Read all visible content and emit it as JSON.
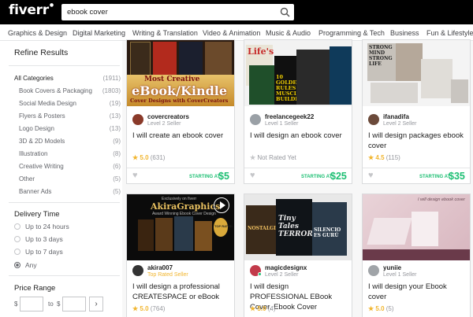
{
  "header": {
    "logo": "fiverr",
    "search_value": "ebook cover"
  },
  "nav": {
    "items": [
      "Graphics & Design",
      "Digital Marketing",
      "Writing & Translation",
      "Video & Animation",
      "Music & Audio",
      "Programming & Tech",
      "Business",
      "Fun & Lifestyle"
    ]
  },
  "sidebar": {
    "title": "Refine Results",
    "categories": [
      {
        "label": "All Categories",
        "count": "(1911)"
      },
      {
        "label": "Book Covers & Packaging",
        "count": "(1803)"
      },
      {
        "label": "Social Media Design",
        "count": "(19)"
      },
      {
        "label": "Flyers & Posters",
        "count": "(13)"
      },
      {
        "label": "Logo Design",
        "count": "(13)"
      },
      {
        "label": "3D & 2D Models",
        "count": "(9)"
      },
      {
        "label": "Illustration",
        "count": "(8)"
      },
      {
        "label": "Creative Writing",
        "count": "(6)"
      },
      {
        "label": "Other",
        "count": "(5)"
      },
      {
        "label": "Banner Ads",
        "count": "(5)"
      }
    ],
    "delivery_title": "Delivery Time",
    "delivery_options": [
      "Up to 24 hours",
      "Up to 3 days",
      "Up to 7 days",
      "Any"
    ],
    "delivery_selected": "Any",
    "price_title": "Price Range",
    "price_currency": "$",
    "price_to": "to",
    "price_go": "›"
  },
  "gigs": [
    {
      "seller": "covercreators",
      "level": "Level 2 Seller",
      "title": "I will create an ebook cover",
      "rating": "5.0",
      "reviews": "(631)",
      "starting": "STARTING AT",
      "price": "$5",
      "thumb_text": [
        "Most Creative",
        "eBook/Kindle",
        "Cover Designs with CoverCreators"
      ]
    },
    {
      "seller": "freelancegeek22",
      "level": "Level 1 Seller",
      "title": "I will design an ebook cover",
      "rating": "",
      "reviews": "Not Rated Yet",
      "starting": "STARTING AT",
      "price": "$25",
      "thumb_text": [
        "Life's",
        "10 GOLDEN RULES OF MUSCLE BUILDING"
      ]
    },
    {
      "seller": "ifanadifa",
      "level": "Level 2 Seller",
      "title": "I will design packages ebook cover",
      "rating": "4.5",
      "reviews": "(115)",
      "starting": "STARTING AT",
      "price": "$35",
      "thumb_text": [
        "STRONG MIND STRONG LIFE"
      ]
    },
    {
      "seller": "akira007",
      "level": "Top Rated Seller",
      "title": "I will design a professional CREATESPACE or eBook",
      "rating": "5.0",
      "reviews": "(764)",
      "thumb_text": [
        "Exclusively on fiverr",
        "AkiraGraphics",
        "Award Winning Ebook Cover Design",
        "TOP RATED"
      ]
    },
    {
      "seller": "magicdesignx",
      "level": "Level 2 Seller",
      "title": "I will design PROFESSIONAL EBook Cover, Ebook Cover",
      "rating": "5.0",
      "reviews": "(4)",
      "thumb_text": [
        "NOSTALGIA",
        "Tiny Tales TERROR",
        "SILENCIO ES GURÚ"
      ]
    },
    {
      "seller": "yuniie",
      "level": "Level 1 Seller",
      "title": "I will design your Ebook cover",
      "rating": "5.0",
      "reviews": "(5)",
      "thumb_text": [
        "I will design ebook cover"
      ]
    }
  ]
}
